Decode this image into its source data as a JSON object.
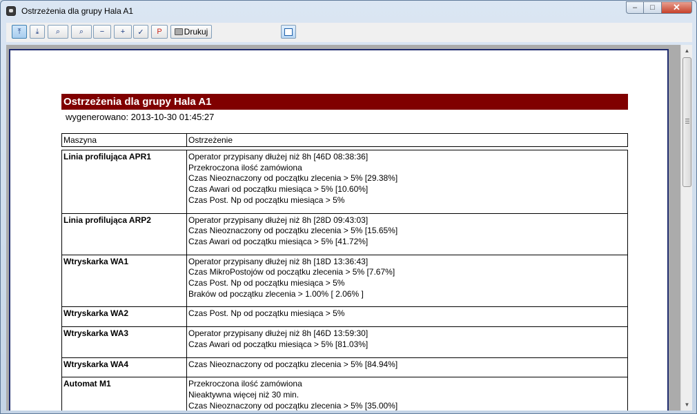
{
  "window": {
    "title": "Ostrzeżenia dla grupy Hala A1",
    "controls": {
      "minimize": "–",
      "maximize": "□",
      "close": "✕"
    }
  },
  "toolbar": {
    "buttons": [
      {
        "name": "first-page",
        "glyph": "⤒"
      },
      {
        "name": "last-page",
        "glyph": "⤓"
      },
      {
        "name": "zoom-page",
        "glyph": "⌕"
      },
      {
        "name": "zoom-width",
        "glyph": "⌕"
      },
      {
        "name": "zoom-out",
        "glyph": "−"
      },
      {
        "name": "zoom-in",
        "glyph": "+"
      },
      {
        "name": "select",
        "glyph": "✓"
      },
      {
        "name": "pdf",
        "glyph": "P"
      }
    ],
    "print_label": "Drukuj"
  },
  "report": {
    "title": "Ostrzeżenia dla grupy Hala A1",
    "generated": "wygenerowano: 2013-10-30 01:45:27",
    "columns": {
      "machine": "Maszyna",
      "warning": "Ostrzeżenie"
    },
    "rows": [
      {
        "machine": "Linia profilująca APR1",
        "warnings": [
          "Operator przypisany dłużej niż 8h [46D 08:38:36]",
          "Przekroczona ilość zamówiona",
          "Czas Nieoznaczony od początku zlecenia > 5% [29.38%]",
          "Czas Awari od początku miesiąca > 5% [10.60%]",
          "Czas Post. Np od początku miesiąca > 5%"
        ]
      },
      {
        "machine": "Linia profilująca ARP2",
        "warnings": [
          "Operator przypisany dłużej niż 8h [28D 09:43:03]",
          "Czas Nieoznaczony od początku zlecenia > 5% [15.65%]",
          "Czas Awari od początku miesiąca > 5% [41.72%]"
        ]
      },
      {
        "machine": "Wtryskarka WA1",
        "warnings": [
          "Operator przypisany dłużej niż 8h [18D 13:36:43]",
          "Czas MikroPostojów od początku zlecenia > 5% [7.67%]",
          "Czas Post. Np od początku miesiąca > 5%",
          "Braków od początku zlecenia > 1.00% [ 2.06% ]"
        ]
      },
      {
        "machine": "Wtryskarka WA2",
        "warnings": [
          "Czas Post. Np od początku miesiąca > 5%"
        ]
      },
      {
        "machine": "Wtryskarka WA3",
        "warnings": [
          "Operator przypisany dłużej niż 8h [46D 13:59:30]",
          "Czas Awari od początku miesiąca > 5% [81.03%]"
        ]
      },
      {
        "machine": "Wtryskarka WA4",
        "warnings": [
          "Czas Nieoznaczony od początku zlecenia > 5% [84.94%]"
        ]
      },
      {
        "machine": "Automat M1",
        "warnings": [
          "Przekroczona ilość zamówiona",
          "Nieaktywna więcej niż 30 min.",
          "Czas Nieoznaczony od początku zlecenia > 5% [35.00%]"
        ]
      }
    ]
  },
  "scrollbar": {
    "up": "▲",
    "down": "▼",
    "position": 0.0
  }
}
